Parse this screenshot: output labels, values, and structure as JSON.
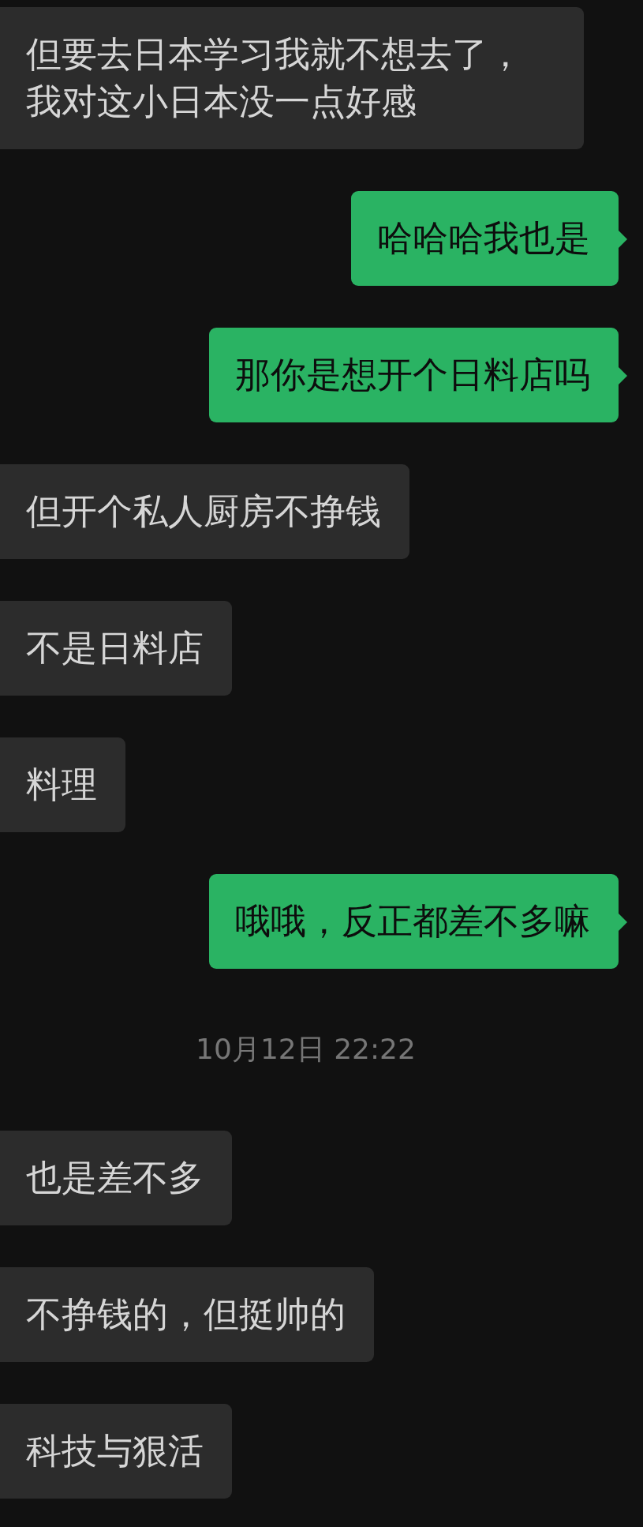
{
  "messages": [
    {
      "kind": "received",
      "text": "但要去日本学习我就不想去了，我对这小日本没一点好感"
    },
    {
      "kind": "sent",
      "text": "哈哈哈我也是"
    },
    {
      "kind": "sent",
      "text": "那你是想开个日料店吗"
    },
    {
      "kind": "received",
      "text": "但开个私人厨房不挣钱"
    },
    {
      "kind": "received",
      "text": "不是日料店"
    },
    {
      "kind": "received",
      "text": "料理"
    },
    {
      "kind": "sent",
      "text": "哦哦，反正都差不多嘛"
    },
    {
      "kind": "timestamp",
      "text": "10月12日 22:22"
    },
    {
      "kind": "received",
      "text": "也是差不多"
    },
    {
      "kind": "received",
      "text": "不挣钱的，但挺帅的"
    },
    {
      "kind": "received",
      "text": "科技与狠活"
    }
  ]
}
